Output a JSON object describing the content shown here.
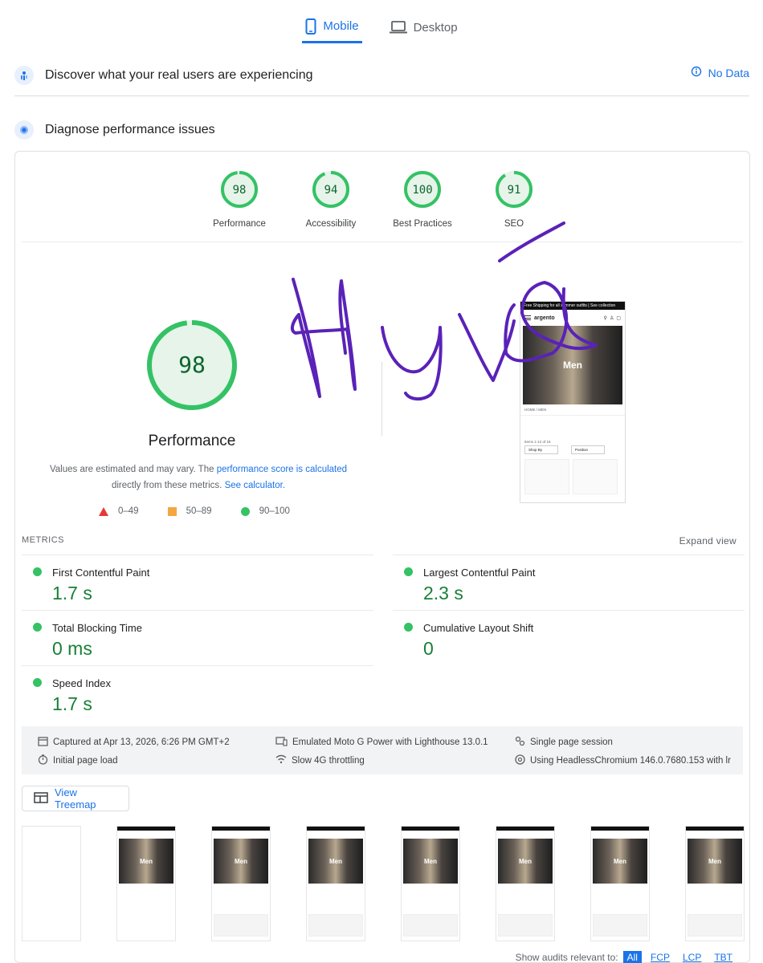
{
  "tabs": [
    {
      "label": "Mobile",
      "active": true
    },
    {
      "label": "Desktop",
      "active": false
    }
  ],
  "field_section": {
    "title": "Discover what your real users are experiencing",
    "status": "No Data"
  },
  "lab_section": {
    "title": "Diagnose performance issues"
  },
  "categories": [
    {
      "score": "98",
      "label": "Performance",
      "fraction": 0.98
    },
    {
      "score": "94",
      "label": "Accessibility",
      "fraction": 0.94
    },
    {
      "score": "100",
      "label": "Best Practices",
      "fraction": 1.0
    },
    {
      "score": "91",
      "label": "SEO",
      "fraction": 0.91
    }
  ],
  "main_score": {
    "score": "98",
    "title": "Performance",
    "fraction": 0.98
  },
  "note": {
    "part1": "Values are estimated and may vary. The ",
    "link1": "performance score is calculated",
    "part2": "directly from these metrics. ",
    "link2": "See calculator."
  },
  "legend": [
    {
      "range": "0–49",
      "shape": "triangle",
      "color": "#e53935"
    },
    {
      "range": "50–89",
      "shape": "square",
      "color": "#f4a740"
    },
    {
      "range": "90–100",
      "shape": "circle",
      "color": "#34c265"
    }
  ],
  "preview": {
    "banner": "Free Shipping for all summer outfits | See collection",
    "brand": "argento",
    "hero_text": "Men",
    "breadcrumb": "HOME / MEN",
    "items_count": "Items 1-12 of 16",
    "filter": "Shop By",
    "sort": "Position"
  },
  "metrics": {
    "header": "METRICS",
    "expand_label": "Expand view",
    "items": [
      {
        "name": "First Contentful Paint",
        "value": "1.7 s"
      },
      {
        "name": "Largest Contentful Paint",
        "value": "2.3 s"
      },
      {
        "name": "Total Blocking Time",
        "value": "0 ms"
      },
      {
        "name": "Cumulative Layout Shift",
        "value": "0"
      },
      {
        "name": "Speed Index",
        "value": "1.7 s"
      }
    ]
  },
  "capture_info": {
    "captured": "Captured at Apr 13, 2026, 6:26 PM GMT+2",
    "load": "Initial page load",
    "device": "Emulated Moto G Power with Lighthouse 13.0.1",
    "throttling": "Slow 4G throttling",
    "session": "Single page session",
    "browser": "Using HeadlessChromium 146.0.7680.153 with lr"
  },
  "treemap_label": "View Treemap",
  "filmstrip_hero": "Men",
  "audits": {
    "label": "Show audits relevant to:",
    "filters": [
      "All",
      "FCP",
      "LCP",
      "TBT"
    ]
  },
  "colors": {
    "accent": "#1a73e8",
    "good": "#34c265",
    "good_text": "#188038",
    "scrawl": "#5a22b8"
  }
}
